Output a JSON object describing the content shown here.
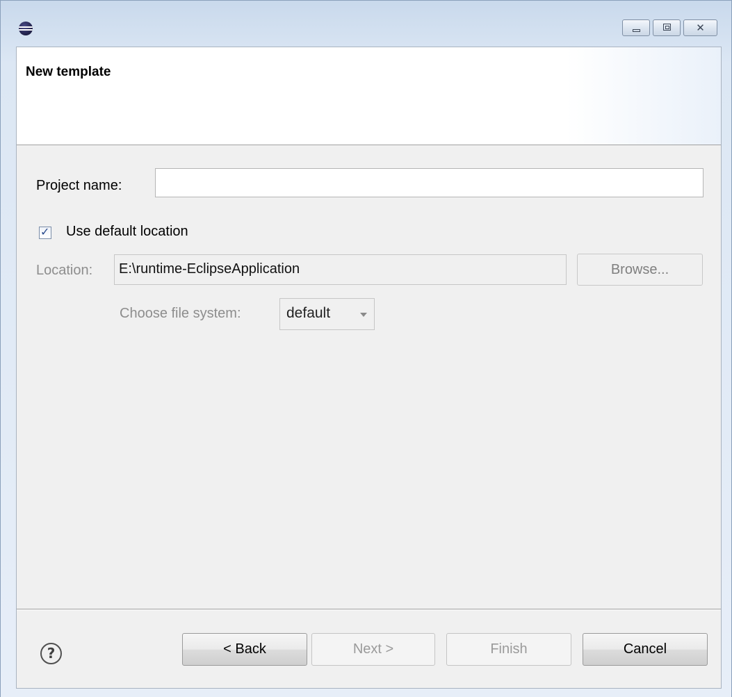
{
  "window": {
    "icon": "eclipse-icon",
    "controls": {
      "minimize_icon": "minimize-icon",
      "maximize_icon": "maximize-icon",
      "close_glyph": "✕"
    }
  },
  "header": {
    "title": "New template"
  },
  "form": {
    "project_name": {
      "label": "Project name:",
      "value": ""
    },
    "use_default_location": {
      "label": "Use default location",
      "checked": true
    },
    "location": {
      "label": "Location:",
      "value": "E:\\runtime-EclipseApplication",
      "browse_label": "Browse..."
    },
    "file_system": {
      "label": "Choose file system:",
      "selected": "default"
    }
  },
  "footer": {
    "help_glyph": "?",
    "back_label": "< Back",
    "next_label": "Next >",
    "finish_label": "Finish",
    "cancel_label": "Cancel"
  },
  "colors": {
    "title_gradient_top": "#c9d9ec",
    "dialog_background": "#f0f0f0",
    "disabled_text": "#8d8d8d"
  }
}
